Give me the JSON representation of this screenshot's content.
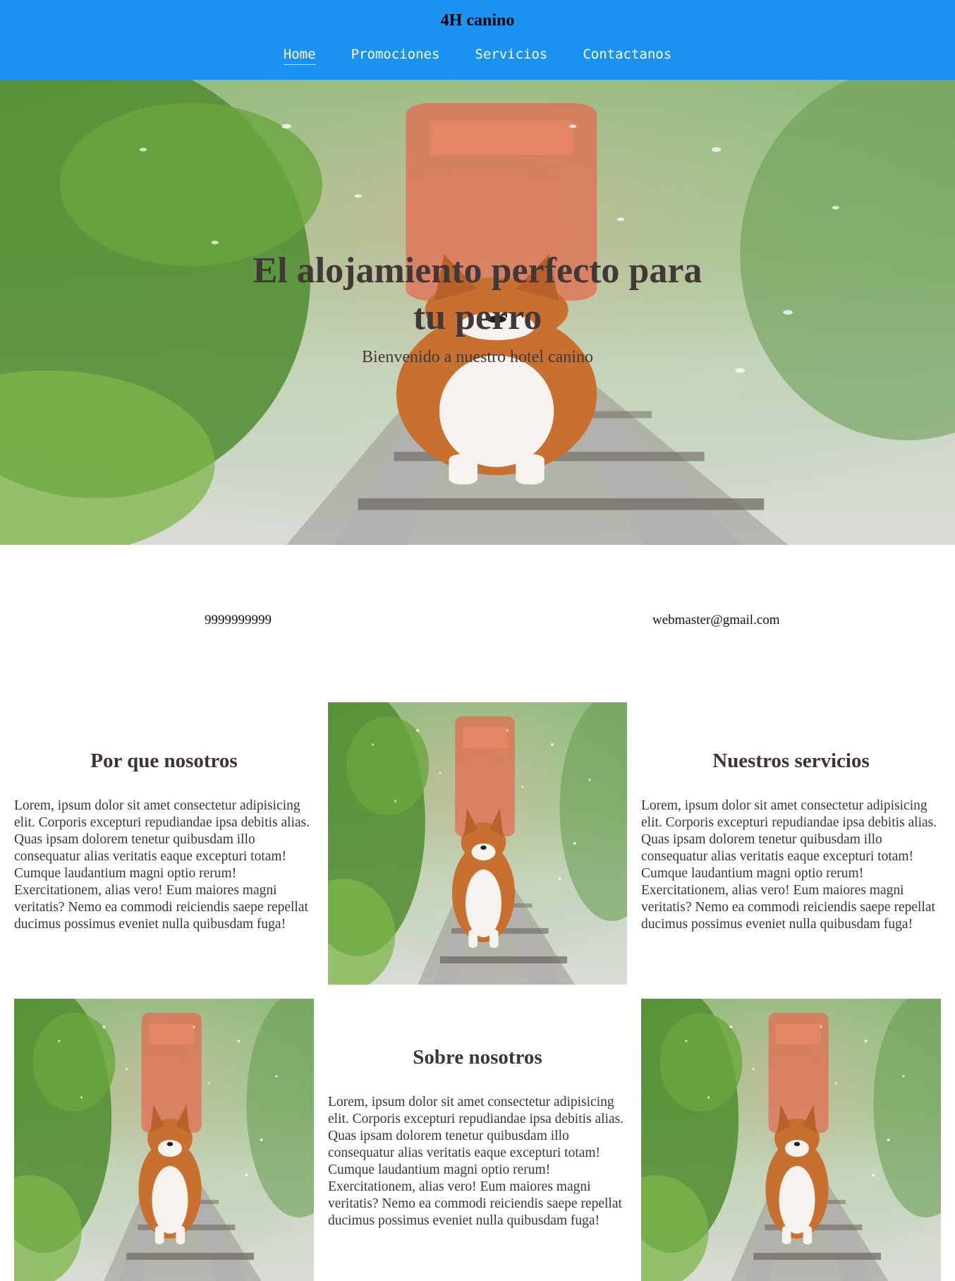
{
  "header": {
    "brand": "4H canino",
    "nav": [
      {
        "label": "Home",
        "active": true
      },
      {
        "label": "Promociones",
        "active": false
      },
      {
        "label": "Servicios",
        "active": false
      },
      {
        "label": "Contactanos",
        "active": false
      }
    ],
    "background_color": "#1a93f0"
  },
  "hero": {
    "title": "El alojamiento perfecto para tu perro",
    "subtitle": "Bienvenido a nuestro hotel canino",
    "image": "corgi-on-railway-photo"
  },
  "contact": {
    "phone": "9999999999",
    "email": "webmaster@gmail.com"
  },
  "sections": {
    "why_us": {
      "title": "Por que nosotros",
      "text": "Lorem, ipsum dolor sit amet consectetur adipisicing elit. Corporis excepturi repudiandae ipsa debitis alias. Quas ipsam dolorem tenetur quibusdam illo consequatur alias veritatis eaque excepturi totam! Cumque laudantium magni optio rerum! Exercitationem, alias vero! Eum maiores magni veritatis? Nemo ea commodi reiciendis saepe repellat ducimus possimus eveniet nulla quibusdam fuga!"
    },
    "services": {
      "title": "Nuestros servicios",
      "text": "Lorem, ipsum dolor sit amet consectetur adipisicing elit. Corporis excepturi repudiandae ipsa debitis alias. Quas ipsam dolorem tenetur quibusdam illo consequatur alias veritatis eaque excepturi totam! Cumque laudantium magni optio rerum! Exercitationem, alias vero! Eum maiores magni veritatis? Nemo ea commodi reiciendis saepe repellat ducimus possimus eveniet nulla quibusdam fuga!"
    },
    "about": {
      "title": "Sobre nosotros",
      "text": "Lorem, ipsum dolor sit amet consectetur adipisicing elit. Corporis excepturi repudiandae ipsa debitis alias. Quas ipsam dolorem tenetur quibusdam illo consequatur alias veritatis eaque excepturi totam! Cumque laudantium magni optio rerum! Exercitationem, alias vero! Eum maiores magni veritatis? Nemo ea commodi reiciendis saepe repellat ducimus possimus eveniet nulla quibusdam fuga!"
    }
  }
}
